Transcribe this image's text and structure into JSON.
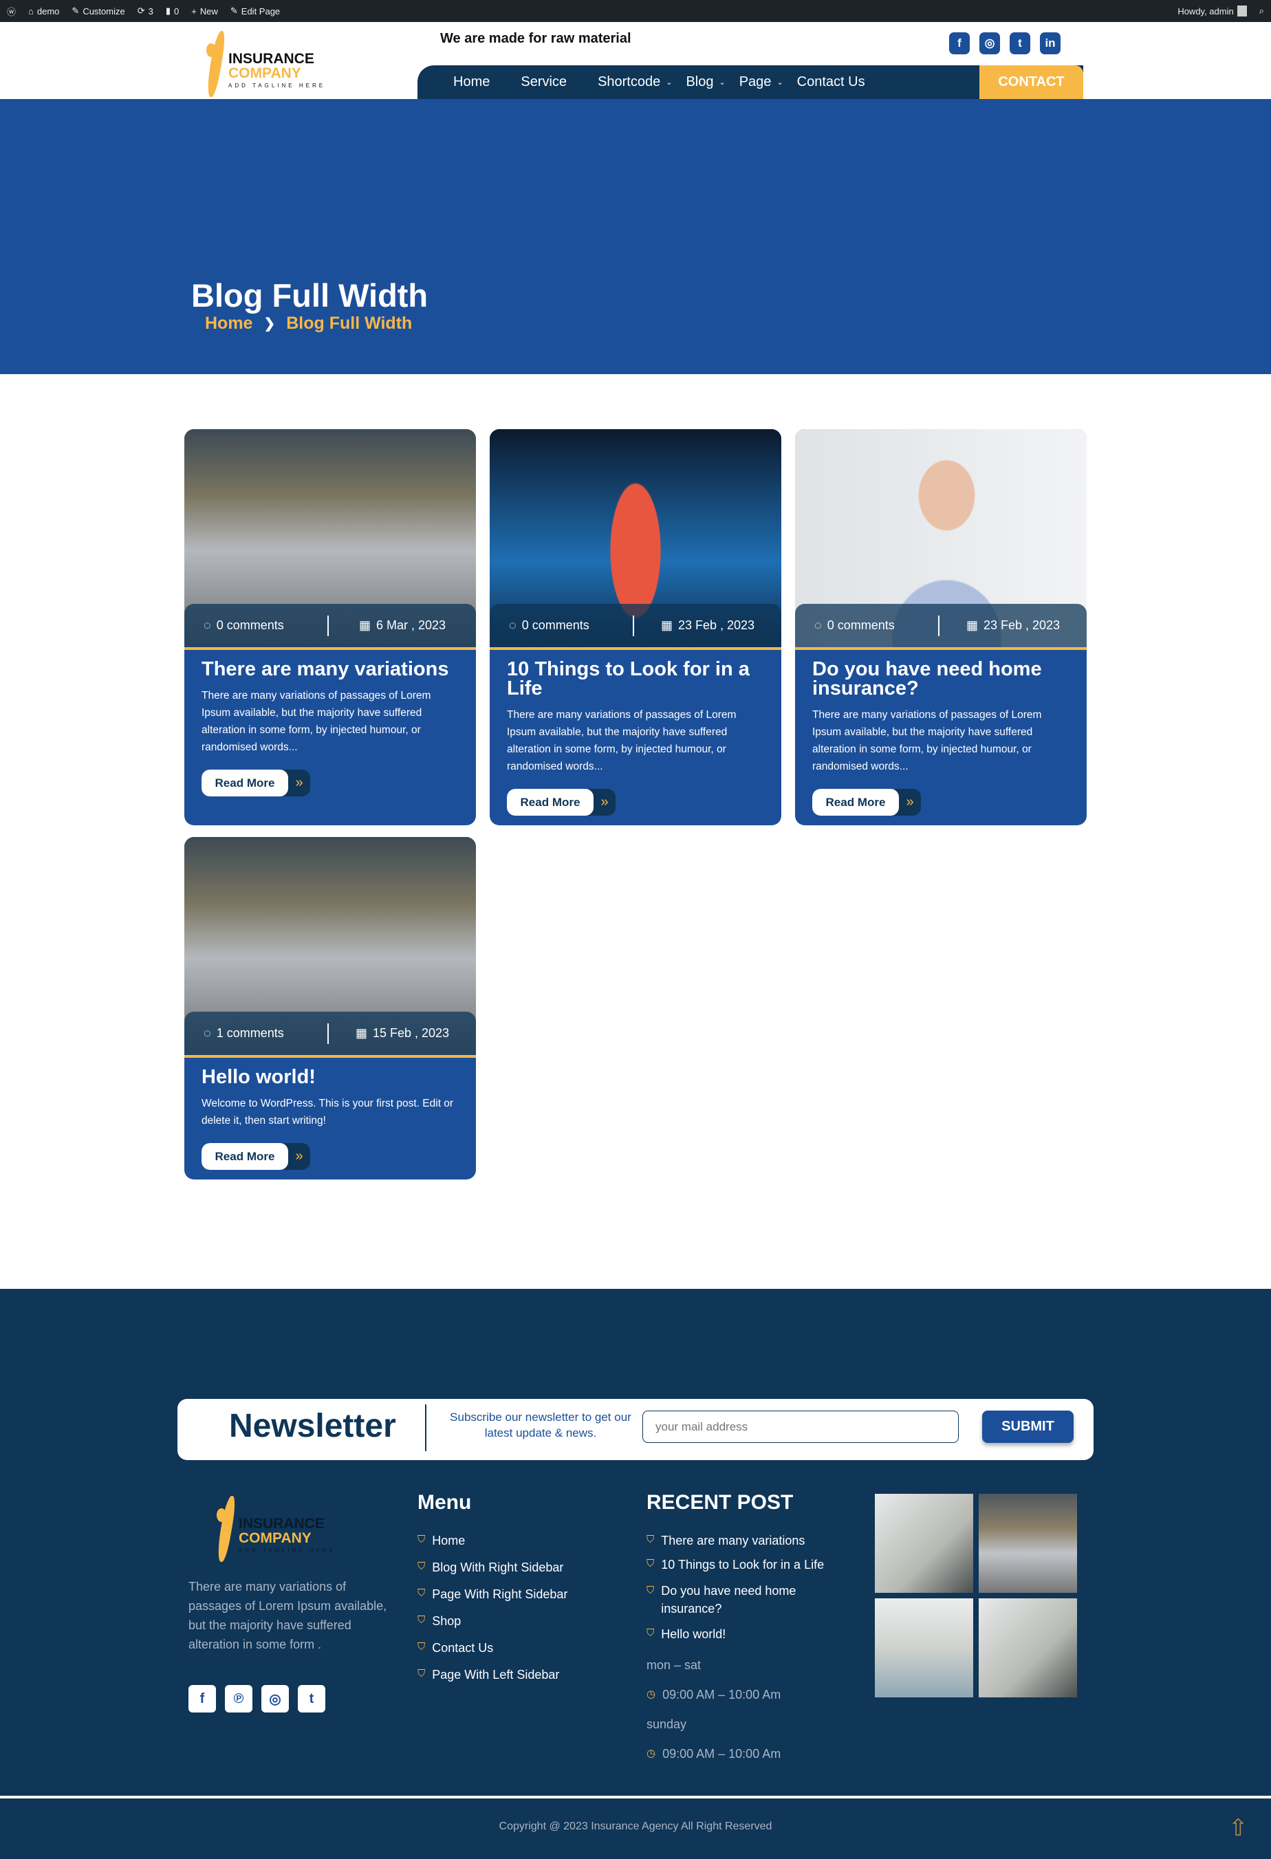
{
  "admin_bar": {
    "site": "demo",
    "customize": "Customize",
    "updates": "3",
    "comments": "0",
    "new": "New",
    "edit": "Edit Page",
    "howdy": "Howdy, admin"
  },
  "header": {
    "logo": {
      "line1": "INSURANCE",
      "line2": "COMPANY",
      "line3": "ADD TAGLINE HERE"
    },
    "tagline": "We are made for raw material",
    "social": [
      {
        "icon": "facebook-icon",
        "glyph": "f"
      },
      {
        "icon": "instagram-icon",
        "glyph": "◎"
      },
      {
        "icon": "twitter-icon",
        "glyph": "t"
      },
      {
        "icon": "linkedin-icon",
        "glyph": "in"
      }
    ],
    "nav": [
      {
        "label": "Home"
      },
      {
        "label": "Service"
      },
      {
        "label": "Shortcode",
        "dropdown": true
      },
      {
        "label": "Blog",
        "dropdown": true
      },
      {
        "label": "Page",
        "dropdown": true
      },
      {
        "label": "Contact Us"
      }
    ],
    "contact": "CONTACT"
  },
  "hero": {
    "title": "Blog Full Width",
    "breadcrumb": [
      "Home",
      "Blog Full Width"
    ]
  },
  "posts": [
    {
      "comments": "0 comments",
      "date": "6 Mar , 2023",
      "title": "There are many variations",
      "excerpt": "There are many variations of passages of Lorem Ipsum available, but the majority have suffered alteration in some form, by injected humour, or randomised words...",
      "read_more": "Read More"
    },
    {
      "comments": "0 comments",
      "date": "23 Feb , 2023",
      "title": "10 Things to Look for in a Life",
      "excerpt": "There are many variations of passages of Lorem Ipsum available, but the majority have suffered alteration in some form, by injected humour, or randomised words...",
      "read_more": "Read More"
    },
    {
      "comments": "0 comments",
      "date": "23 Feb , 2023",
      "title": "Do you have need home insurance?",
      "excerpt": "There are many variations of passages of Lorem Ipsum available, but the majority have suffered alteration in some form, by injected humour, or randomised words...",
      "read_more": "Read More"
    },
    {
      "comments": "1 comments",
      "date": "15 Feb , 2023",
      "title": "Hello world!",
      "excerpt": "Welcome to WordPress. This is your first post. Edit or delete it, then start writing!",
      "read_more": "Read More"
    }
  ],
  "newsletter": {
    "title": "Newsletter",
    "subtitle": "Subscribe our newsletter to get our latest update & news.",
    "placeholder": "your mail address",
    "submit": "SUBMIT"
  },
  "footer": {
    "about": "There are many variations of passages of Lorem Ipsum available, but the majority have suffered alteration in some form .",
    "menu_title": "Menu",
    "menu": [
      "Home",
      "Blog With Right Sidebar",
      "Page With Right Sidebar",
      "Shop",
      "Contact Us",
      "Page With Left Sidebar"
    ],
    "recent_title": "RECENT POST",
    "recent": [
      "There are many variations",
      "10 Things to Look for in a Life",
      "Do you have need home insurance?",
      "Hello world!"
    ],
    "hours": [
      {
        "days": "mon – sat",
        "time": "09:00 AM – 10:00 Am"
      },
      {
        "days": "sunday",
        "time": "09:00 AM – 10:00 Am"
      }
    ],
    "copyright": "Copyright @ 2023 Insurance Agency All Right Reserved"
  },
  "colors": {
    "primary": "#1c4f99",
    "dark": "#0f3557",
    "accent": "#f8b846"
  }
}
